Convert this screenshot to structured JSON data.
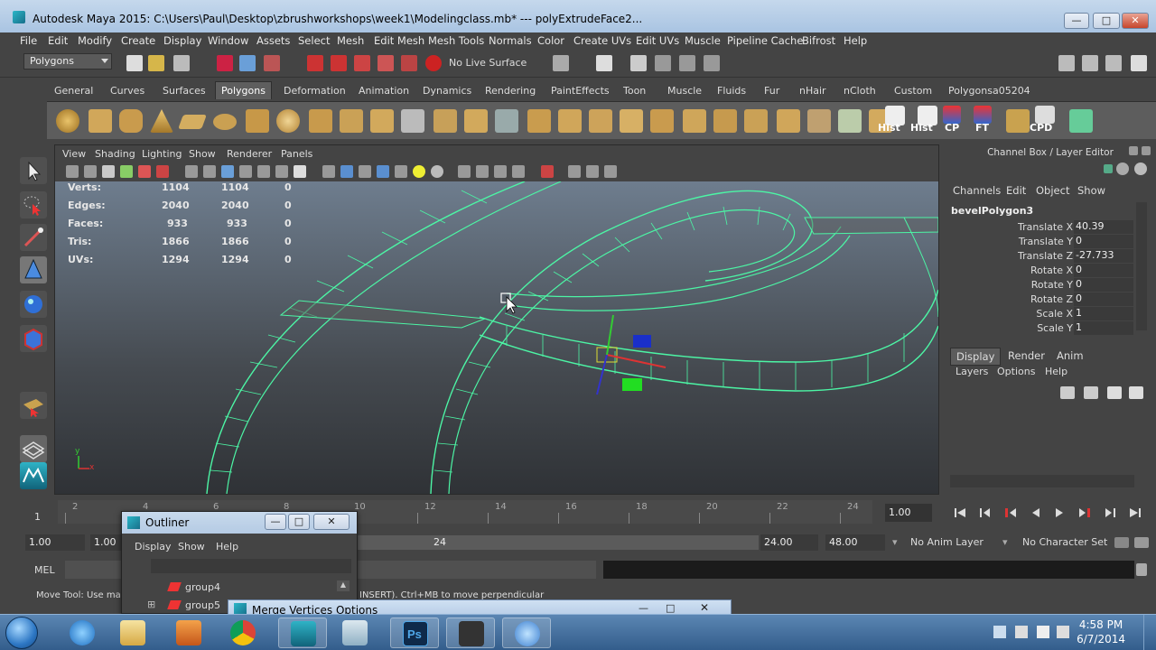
{
  "window": {
    "title": "Autodesk Maya 2015: C:\\Users\\Paul\\Desktop\\zbrushworkshops\\week1\\Modelingclass.mb*   ---   polyExtrudeFace2...",
    "minimize": "—",
    "maximize": "□",
    "close": "✕"
  },
  "menubar": [
    "File",
    "Edit",
    "Modify",
    "Create",
    "Display",
    "Window",
    "Assets",
    "Select",
    "Mesh",
    "Edit Mesh",
    "Mesh Tools",
    "Normals",
    "Color",
    "Create UVs",
    "Edit UVs",
    "Muscle",
    "Pipeline Cache",
    "Bifrost",
    "Help"
  ],
  "statusline": {
    "mode": "Polygons",
    "live_surface": "No Live Surface"
  },
  "shelf": {
    "tabs": [
      "General",
      "Curves",
      "Surfaces",
      "Polygons",
      "Deformation",
      "Animation",
      "Dynamics",
      "Rendering",
      "PaintEffects",
      "Toon",
      "Muscle",
      "Fluids",
      "Fur",
      "nHair",
      "nCloth",
      "Custom",
      "Polygonsa05204"
    ],
    "active_tab": "Polygons",
    "labels": [
      "Hist",
      "Hist",
      "CP",
      "FT",
      "CPD"
    ]
  },
  "panel": {
    "menu": [
      "View",
      "Shading",
      "Lighting",
      "Show",
      "Renderer",
      "Panels"
    ]
  },
  "hud": {
    "rows": [
      {
        "label": "Verts:",
        "a": "1104",
        "b": "1104",
        "c": "0"
      },
      {
        "label": "Edges:",
        "a": "2040",
        "b": "2040",
        "c": "0"
      },
      {
        "label": "Faces:",
        "a": "933",
        "b": "933",
        "c": "0"
      },
      {
        "label": "Tris:",
        "a": "1866",
        "b": "1866",
        "c": "0"
      },
      {
        "label": "UVs:",
        "a": "1294",
        "b": "1294",
        "c": "0"
      }
    ]
  },
  "channel_box": {
    "title": "Channel Box / Layer Editor",
    "menu": [
      "Channels",
      "Edit",
      "Object",
      "Show"
    ],
    "node": "bevelPolygon3",
    "attributes": [
      {
        "name": "Translate X",
        "value": "40.39"
      },
      {
        "name": "Translate Y",
        "value": "0"
      },
      {
        "name": "Translate Z",
        "value": "-27.733"
      },
      {
        "name": "Rotate X",
        "value": "0"
      },
      {
        "name": "Rotate Y",
        "value": "0"
      },
      {
        "name": "Rotate Z",
        "value": "0"
      },
      {
        "name": "Scale X",
        "value": "1"
      },
      {
        "name": "Scale Y",
        "value": "1"
      }
    ],
    "layer_tabs": [
      "Display",
      "Render",
      "Anim"
    ],
    "layer_menu": [
      "Layers",
      "Options",
      "Help"
    ]
  },
  "timeslider": {
    "labels": [
      "2",
      "4",
      "6",
      "8",
      "10",
      "12",
      "14",
      "16",
      "18",
      "20",
      "22",
      "24"
    ],
    "start_label": "1",
    "current_frame": "1.00"
  },
  "range": {
    "start": "1.00",
    "anim_start": "1.00",
    "range_end_marker": "24",
    "anim_end": "24.00",
    "end": "48.00",
    "anim_layer": "No Anim Layer",
    "character_set": "No Character Set"
  },
  "cmdline": {
    "label": "MEL"
  },
  "helpline": {
    "left": "Move Tool: Use man",
    "right": "INSERT). Ctrl+MB to move perpendicular"
  },
  "outliner": {
    "title": "Outliner",
    "menu": [
      "Display",
      "Show",
      "Help"
    ],
    "items": [
      "group4",
      "group5"
    ]
  },
  "merge_dialog": {
    "title": "Merge Vertices Options"
  },
  "taskbar": {
    "time": "4:58 PM",
    "date": "6/7/2014"
  },
  "colors": {
    "wire": "#4cf5a5",
    "maya_bg": "#444444"
  }
}
